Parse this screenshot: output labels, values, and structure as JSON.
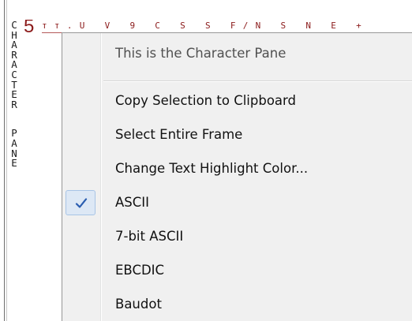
{
  "pane": {
    "vertical_label_top": [
      "C",
      "H",
      "A",
      "R",
      "A",
      "C",
      "T",
      "E",
      "R"
    ],
    "vertical_label_bottom": [
      "P",
      "A",
      "N",
      "E"
    ],
    "row_digit": "5",
    "row_chars": "тт.U V 9 C S S F/N S N E +"
  },
  "menu": {
    "header": "This is the Character Pane",
    "items": [
      {
        "label": "Copy Selection to Clipboard",
        "checked": false
      },
      {
        "label": "Select Entire Frame",
        "checked": false
      },
      {
        "label": "Change Text Highlight Color...",
        "checked": false
      },
      {
        "label": "ASCII",
        "checked": true
      },
      {
        "label": "7-bit ASCII",
        "checked": false
      },
      {
        "label": "EBCDIC",
        "checked": false
      },
      {
        "label": "Baudot",
        "checked": false
      }
    ]
  },
  "colors": {
    "check_mark": "#2a5db0",
    "check_highlight_bg": "#dde8f5",
    "char_row": "#8b1a1a"
  }
}
